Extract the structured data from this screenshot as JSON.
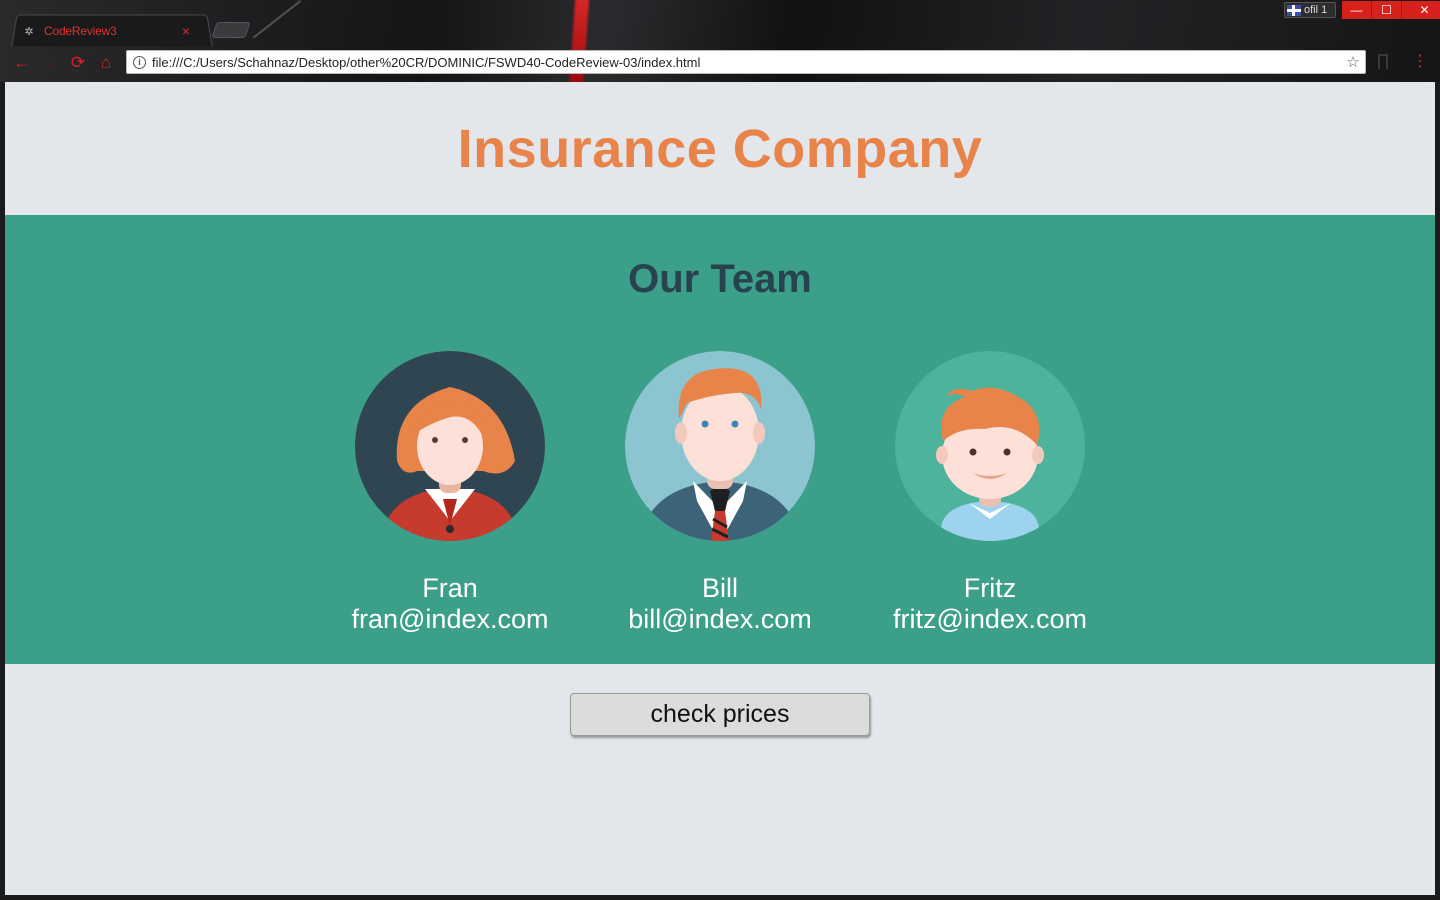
{
  "browser": {
    "tab_title": "CodeReview3",
    "tab_close": "×",
    "profile_label": "ofil 1",
    "url": "file:///C:/Users/Schahnaz/Desktop/other%20CR/DOMINIC/FSWD40-CodeReview-03/index.html",
    "window_buttons": {
      "minimize": "—",
      "maximize": "☐",
      "close": "✕"
    },
    "nav_icons": {
      "back": "←",
      "forward": "→",
      "reload": "⟳",
      "home": "⌂",
      "star": "☆",
      "menu": "⋮",
      "info": "i"
    }
  },
  "page": {
    "title_light": "Insurance ",
    "title_bold": "Company",
    "team_heading": "Our Team",
    "members": [
      {
        "name": "Fran",
        "email": "fran@index.com",
        "avatar": "woman-avatar-icon"
      },
      {
        "name": "Bill",
        "email": "bill@index.com",
        "avatar": "man-avatar-icon"
      },
      {
        "name": "Fritz",
        "email": "fritz@index.com",
        "avatar": "boy-avatar-icon"
      }
    ],
    "cta_label": "check prices"
  },
  "colors": {
    "accent": "#e8834a",
    "team_bg": "#3b9f8a",
    "heading": "#29434e",
    "page_bg": "#e3e7eb"
  }
}
